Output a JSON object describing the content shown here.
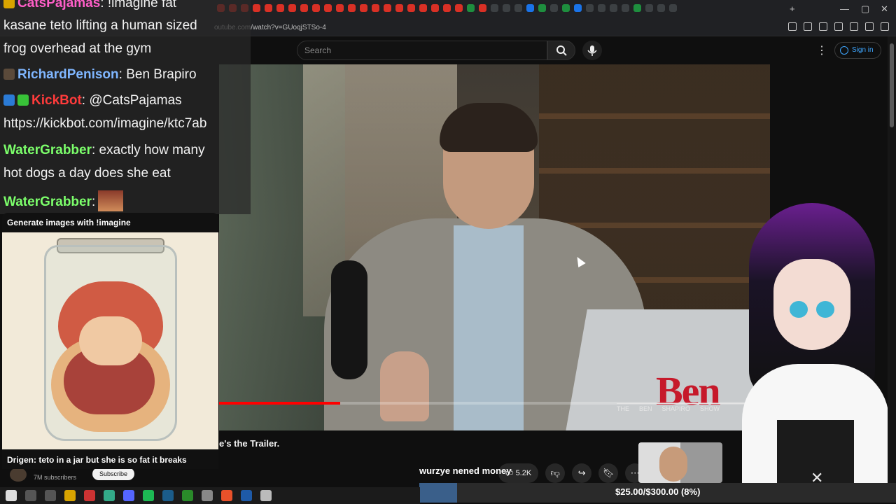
{
  "browser": {
    "url": "outube.com/watch?v=GUoqjSTSo-4"
  },
  "youtube": {
    "search_placeholder": "Search",
    "sign_in": "Sign in",
    "title_fragment": "e's the Trailer.",
    "channel_subs": "7M subscribers",
    "subscribe": "Subscribe",
    "like_count": "5.2K",
    "video_progress_fraction": 0.22,
    "overlay_logo": "Ben",
    "overlay_logo_words": [
      "THE",
      "BEN",
      "SHAPIRO",
      "SHOW"
    ]
  },
  "chat": {
    "top_user": "CatsPajamas",
    "top_text": ": !imagine fat",
    "line2": "kasane teto lifting a human sized",
    "line3": "frog overhead at the gym",
    "messages": [
      {
        "user": "RichardPenison",
        "text": ": Ben Brapiro"
      },
      {
        "user": "KickBot",
        "text": ": @CatsPajamas"
      },
      {
        "user": "",
        "text": "https://kickbot.com/imagine/ktc7ab"
      },
      {
        "user": "WaterGrabber",
        "text": ": exactly how many"
      },
      {
        "user": "",
        "text": "hot dogs a day does she eat"
      },
      {
        "user": "WaterGrabber",
        "text": ":"
      }
    ]
  },
  "imagine_card": {
    "header": "Generate images with !imagine",
    "caption": "Drigen: teto in a jar but she is so fat it breaks"
  },
  "donation": {
    "message": "wurzye nened money",
    "goal_text": "$25.00/$300.00 (8%)",
    "fraction": 0.08
  },
  "colors": {
    "yt_bg": "#0f0f0f",
    "yt_link": "#3ea6ff",
    "progress_red": "#ff0000",
    "kick_red": "#ff3b3b",
    "water_green": "#7cff6b",
    "rich_blue": "#7fb6ff",
    "cats_pink": "#ff5ec8"
  }
}
